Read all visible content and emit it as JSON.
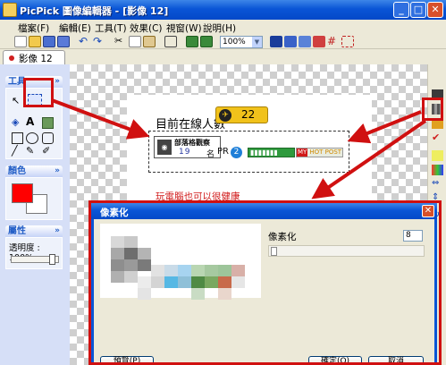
{
  "window": {
    "title": "PicPick 圖像編輯器 - [影像 12]"
  },
  "menu": [
    "檔案(F)",
    "編輯(E)",
    "工具(T)",
    "效果(C)",
    "視窗(W)",
    "說明(H)"
  ],
  "toolbar": {
    "zoom": "100%"
  },
  "tab": {
    "label": "影像 12"
  },
  "left_panel": {
    "tools_header": "工具",
    "color_header": "顏色",
    "props_header": "屬性",
    "opacity_label": "透明度 : 100%",
    "primary_color": "#ff0000",
    "secondary_color": "#ffffff"
  },
  "image": {
    "headline": "目前在線人數",
    "counter_value": "22",
    "badge_title": "部落格觀察",
    "badge_rank": "19",
    "badge_unit": "名",
    "pr_label": "PR",
    "pr_value": "2",
    "hot_my": "MY",
    "hot_text": "HOT POST",
    "caption": "玩電腦也可以很健康"
  },
  "dialog": {
    "title": "像素化",
    "param_label": "像素化",
    "param_value": "8",
    "ok_button": "確定(O)",
    "cancel_button": "取消",
    "preview_button": "預覽(P)"
  },
  "annotation_color": "#d01010"
}
